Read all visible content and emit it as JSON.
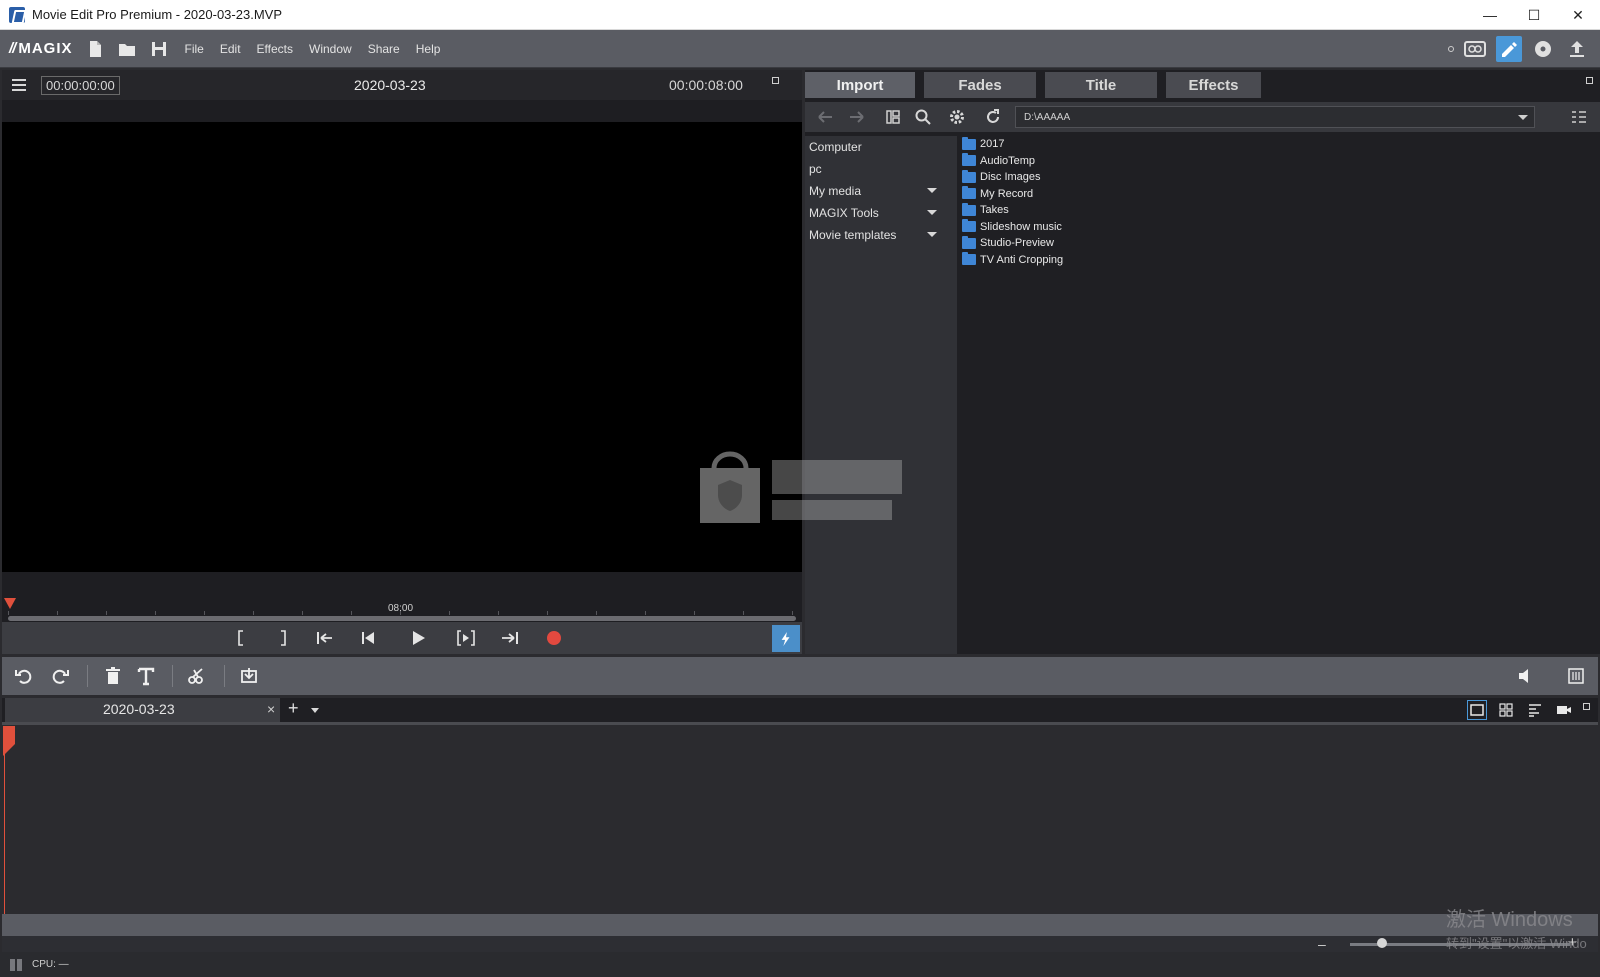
{
  "window": {
    "title": "Movie Edit Pro Premium - 2020-03-23.MVP",
    "controls": {
      "minimize": "—",
      "maximize": "☐",
      "close": "✕"
    }
  },
  "menubar": {
    "logo": "MAGIX",
    "menus": [
      "File",
      "Edit",
      "Effects",
      "Window",
      "Share",
      "Help"
    ]
  },
  "preview": {
    "timecode_start": "00:00:00:00",
    "title": "2020-03-23",
    "timecode_end": "00:00:08:00",
    "ruler_label": "08:00"
  },
  "media_pool": {
    "tabs": [
      "Import",
      "Fades",
      "Title",
      "Effects"
    ],
    "active_tab": "Import",
    "path": "D:\\AAAAA",
    "nav_items": [
      {
        "label": "Computer",
        "expandable": false
      },
      {
        "label": "pc",
        "expandable": false
      },
      {
        "label": "My media",
        "expandable": true
      },
      {
        "label": "MAGIX Tools",
        "expandable": true
      },
      {
        "label": "Movie templates",
        "expandable": true
      }
    ],
    "files": [
      "2017",
      "AudioTemp",
      "Disc Images",
      "My Record",
      "Takes",
      "Slideshow music",
      "Studio-Preview",
      "TV Anti Cropping"
    ]
  },
  "timeline": {
    "project_tab": "2020-03-23",
    "close": "×",
    "add": "+"
  },
  "zoom": {
    "minus": "–",
    "plus": "+"
  },
  "status": {
    "cpu": "CPU: —"
  },
  "overlay": {
    "activation_title": "激活 Windows",
    "activation_sub": "转到\"设置\"以激活 Windo"
  },
  "colors": {
    "accent": "#4a98d8",
    "record": "#e2493f",
    "playhead": "#e0503c",
    "folder": "#3f86d6"
  }
}
